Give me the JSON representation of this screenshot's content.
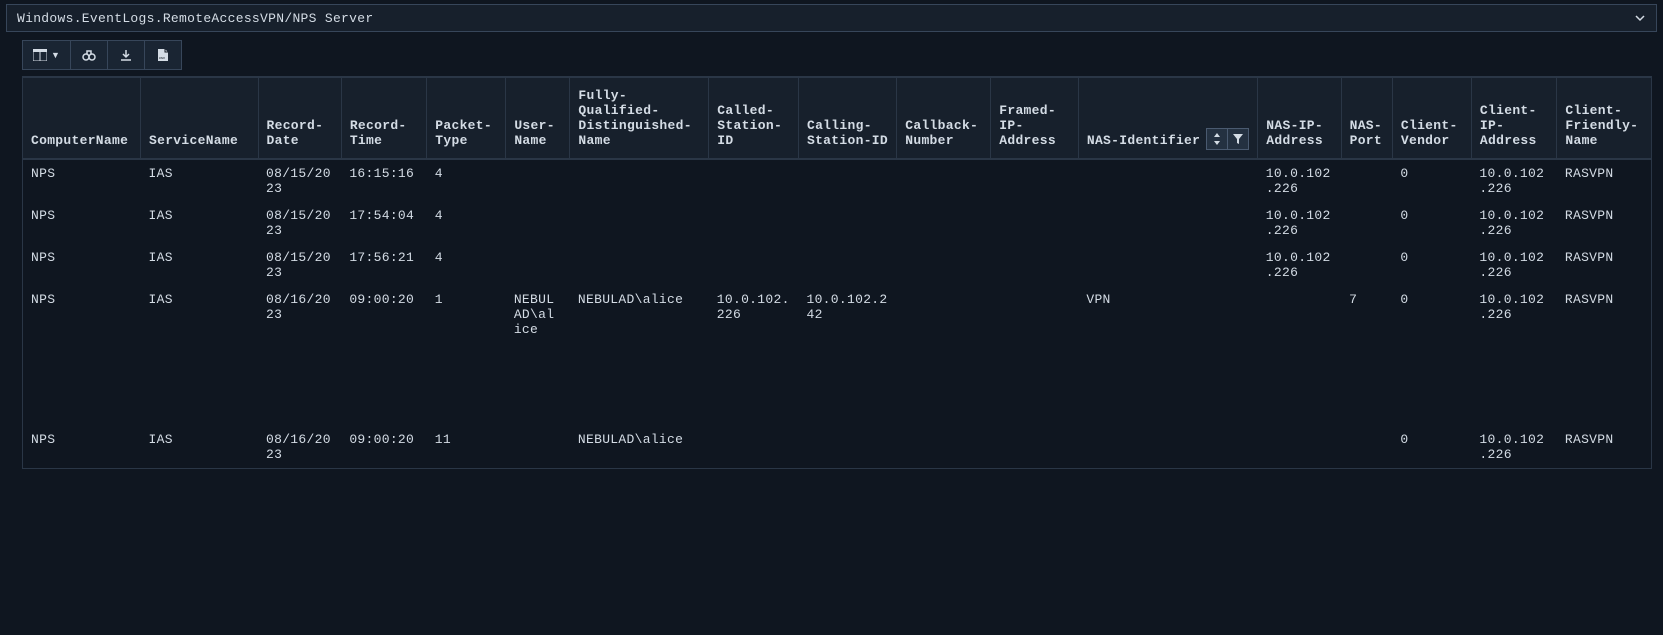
{
  "header": {
    "path": "Windows.EventLogs.RemoteAccessVPN/NPS Server"
  },
  "toolbar": {
    "columns_icon": "columns",
    "search_icon": "binoculars",
    "download_icon": "download",
    "csv_icon": "csv"
  },
  "columns": [
    "ComputerName",
    "ServiceName",
    "Record-Date",
    "Record-Time",
    "Packet-Type",
    "User-Name",
    "Fully-Qualified-Distinguished-Name",
    "Called-Station-ID",
    "Calling-Station-ID",
    "Callback-Number",
    "Framed-IP-Address",
    "NAS-Identifier",
    "NAS-IP-Address",
    "NAS-Port",
    "Client-Vendor",
    "Client-IP-Address",
    "Client-Friendly-Name"
  ],
  "rows": [
    {
      "ComputerName": "NPS",
      "ServiceName": "IAS",
      "RecordDate": "08/15/2023",
      "RecordTime": "16:15:16",
      "PacketType": "4",
      "UserName": "",
      "FQDN": "",
      "CalledStationID": "",
      "CallingStationID": "",
      "CallbackNumber": "",
      "FramedIPAddress": "",
      "NASIdentifier": "",
      "NASIPAddress": "10.0.102.226",
      "NASPort": "",
      "ClientVendor": "0",
      "ClientIPAddress": "10.0.102.226",
      "ClientFriendlyName": "RASVPN"
    },
    {
      "ComputerName": "NPS",
      "ServiceName": "IAS",
      "RecordDate": "08/15/2023",
      "RecordTime": "17:54:04",
      "PacketType": "4",
      "UserName": "",
      "FQDN": "",
      "CalledStationID": "",
      "CallingStationID": "",
      "CallbackNumber": "",
      "FramedIPAddress": "",
      "NASIdentifier": "",
      "NASIPAddress": "10.0.102.226",
      "NASPort": "",
      "ClientVendor": "0",
      "ClientIPAddress": "10.0.102.226",
      "ClientFriendlyName": "RASVPN"
    },
    {
      "ComputerName": "NPS",
      "ServiceName": "IAS",
      "RecordDate": "08/15/2023",
      "RecordTime": "17:56:21",
      "PacketType": "4",
      "UserName": "",
      "FQDN": "",
      "CalledStationID": "",
      "CallingStationID": "",
      "CallbackNumber": "",
      "FramedIPAddress": "",
      "NASIdentifier": "",
      "NASIPAddress": "10.0.102.226",
      "NASPort": "",
      "ClientVendor": "0",
      "ClientIPAddress": "10.0.102.226",
      "ClientFriendlyName": "RASVPN"
    },
    {
      "ComputerName": "NPS",
      "ServiceName": "IAS",
      "RecordDate": "08/16/2023",
      "RecordTime": "09:00:20",
      "PacketType": "1",
      "UserName": "NEBULAD\\alice",
      "FQDN": "NEBULAD\\alice",
      "CalledStationID": "10.0.102.226",
      "CallingStationID": "10.0.102.242",
      "CallbackNumber": "",
      "FramedIPAddress": "",
      "NASIdentifier": "VPN",
      "NASIPAddress": "",
      "NASPort": "7",
      "ClientVendor": "0",
      "ClientIPAddress": "10.0.102.226",
      "ClientFriendlyName": "RASVPN"
    },
    {
      "ComputerName": "NPS",
      "ServiceName": "IAS",
      "RecordDate": "08/16/2023",
      "RecordTime": "09:00:20",
      "PacketType": "11",
      "UserName": "",
      "FQDN": "NEBULAD\\alice",
      "CalledStationID": "",
      "CallingStationID": "",
      "CallbackNumber": "",
      "FramedIPAddress": "",
      "NASIdentifier": "",
      "NASIPAddress": "",
      "NASPort": "",
      "ClientVendor": "0",
      "ClientIPAddress": "10.0.102.226",
      "ClientFriendlyName": "RASVPN"
    }
  ]
}
